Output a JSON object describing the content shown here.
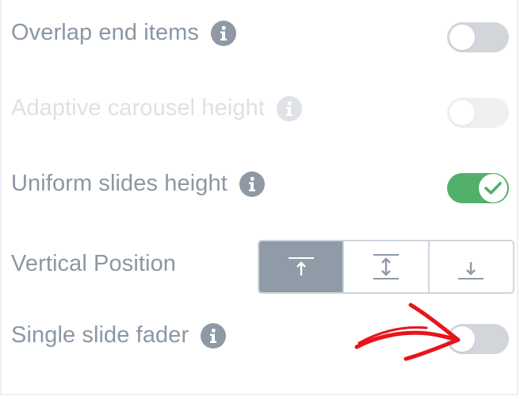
{
  "settings": {
    "overlap_end_items": {
      "label": "Overlap end items",
      "enabled": false,
      "disabled": false
    },
    "adaptive_carousel_height": {
      "label": "Adaptive carousel height",
      "enabled": false,
      "disabled": true
    },
    "uniform_slides_height": {
      "label": "Uniform slides height",
      "enabled": true,
      "disabled": false
    },
    "vertical_position": {
      "label": "Vertical Position",
      "options": [
        "top",
        "middle",
        "bottom"
      ],
      "selected": "top"
    },
    "single_slide_fader": {
      "label": "Single slide fader",
      "enabled": false,
      "disabled": false
    }
  },
  "icons": {
    "info": "info-icon",
    "checkmark": "checkmark-icon",
    "align_top": "align-top-icon",
    "align_middle": "align-middle-icon",
    "align_bottom": "align-bottom-icon",
    "annotation_arrow": "red-arrow-annotation"
  },
  "colors": {
    "label": "#8b97a4",
    "label_disabled": "#dde1e6",
    "toggle_off": "#d2d6db",
    "toggle_on": "#52b06b",
    "segment_active": "#8f9ba6",
    "annotation": "#e8141a"
  }
}
